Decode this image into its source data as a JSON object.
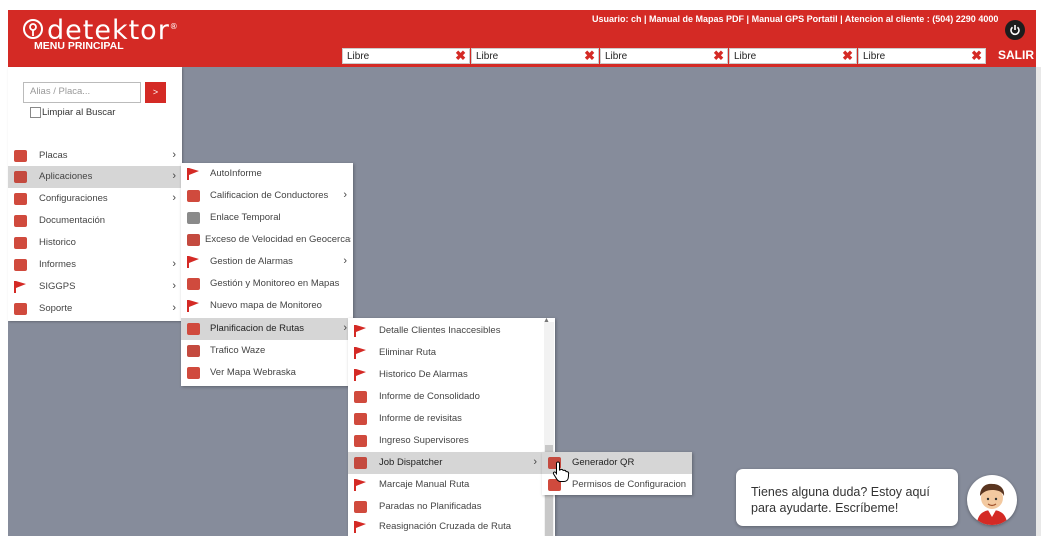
{
  "header": {
    "brand": "detektor",
    "brand_mark": "®",
    "menu_title": "MENU PRINCIPAL",
    "top_links": "Usuario: ch | Manual de Mapas PDF | Manual GPS Portatil | Atencion al cliente : (504) 2290 4000",
    "logout_label": "SALIR",
    "slots": [
      {
        "label": "Libre",
        "close": "✖"
      },
      {
        "label": "Libre",
        "close": "✖"
      },
      {
        "label": "Libre",
        "close": "✖"
      },
      {
        "label": "Libre",
        "close": "✖"
      },
      {
        "label": "Libre",
        "close": "✖"
      }
    ],
    "accent_color": "#d42a25"
  },
  "sidebar": {
    "search_placeholder": "Alias / Placa...",
    "search_button": ">",
    "clear_on_search_label": "Limpiar al Buscar",
    "items": [
      {
        "label": "Placas",
        "icon": "plates-icon",
        "arrow": "›"
      },
      {
        "label": "Aplicaciones",
        "icon": "apps-icon",
        "arrow": "›"
      },
      {
        "label": "Configuraciones",
        "icon": "config-icon",
        "arrow": "›"
      },
      {
        "label": "Documentación",
        "icon": "document-icon",
        "arrow": ""
      },
      {
        "label": "Historico",
        "icon": "history-icon",
        "arrow": ""
      },
      {
        "label": "Informes",
        "icon": "reports-icon",
        "arrow": "›"
      },
      {
        "label": "SIGGPS",
        "icon": "flag-icon",
        "arrow": "›"
      },
      {
        "label": "Soporte",
        "icon": "support-icon",
        "arrow": "›"
      }
    ]
  },
  "submenu_aplicaciones": {
    "items": [
      {
        "label": "AutoInforme",
        "icon": "flag-icon",
        "arrow": ""
      },
      {
        "label": "Calificacion de Conductores",
        "icon": "rating-icon",
        "arrow": "›"
      },
      {
        "label": "Enlace Temporal",
        "icon": "link-icon",
        "arrow": ""
      },
      {
        "label": "Exceso de Velocidad en Geocercas",
        "icon": "speed-icon",
        "arrow": ""
      },
      {
        "label": "Gestion de Alarmas",
        "icon": "flag-icon",
        "arrow": "›"
      },
      {
        "label": "Gestión y Monitoreo en Mapas",
        "icon": "map-icon",
        "arrow": ""
      },
      {
        "label": "Nuevo mapa de Monitoreo",
        "icon": "flag-icon",
        "arrow": ""
      },
      {
        "label": "Planificacion de Rutas",
        "icon": "routes-icon",
        "arrow": "›"
      },
      {
        "label": "Trafico Waze",
        "icon": "waze-icon",
        "arrow": ""
      },
      {
        "label": "Ver Mapa Webraska",
        "icon": "map-icon",
        "arrow": ""
      }
    ]
  },
  "submenu_rutas": {
    "scroll_up": "▲",
    "items": [
      {
        "label": "Detalle Clientes Inaccesibles",
        "icon": "flag-icon",
        "arrow": ""
      },
      {
        "label": "Eliminar Ruta",
        "icon": "flag-icon",
        "arrow": ""
      },
      {
        "label": "Historico De Alarmas",
        "icon": "flag-icon",
        "arrow": ""
      },
      {
        "label": "Informe de Consolidado",
        "icon": "report-icon",
        "arrow": ""
      },
      {
        "label": "Informe de revisitas",
        "icon": "report-icon",
        "arrow": ""
      },
      {
        "label": "Ingreso Supervisores",
        "icon": "supervisor-icon",
        "arrow": ""
      },
      {
        "label": "Job Dispatcher",
        "icon": "dispatcher-icon",
        "arrow": "›"
      },
      {
        "label": "Marcaje Manual Ruta",
        "icon": "flag-icon",
        "arrow": ""
      },
      {
        "label": "Paradas no Planificadas",
        "icon": "report-icon",
        "arrow": ""
      },
      {
        "label": "Reasignación Cruzada de Ruta",
        "icon": "flag-icon",
        "arrow": ""
      }
    ]
  },
  "submenu_dispatcher": {
    "items": [
      {
        "label": "Generador QR",
        "icon": "qr-icon"
      },
      {
        "label": "Permisos de Configuracion",
        "icon": "permissions-icon"
      }
    ]
  },
  "chat": {
    "message": "Tienes alguna duda? Estoy aquí para ayudarte. Escríbeme!"
  }
}
